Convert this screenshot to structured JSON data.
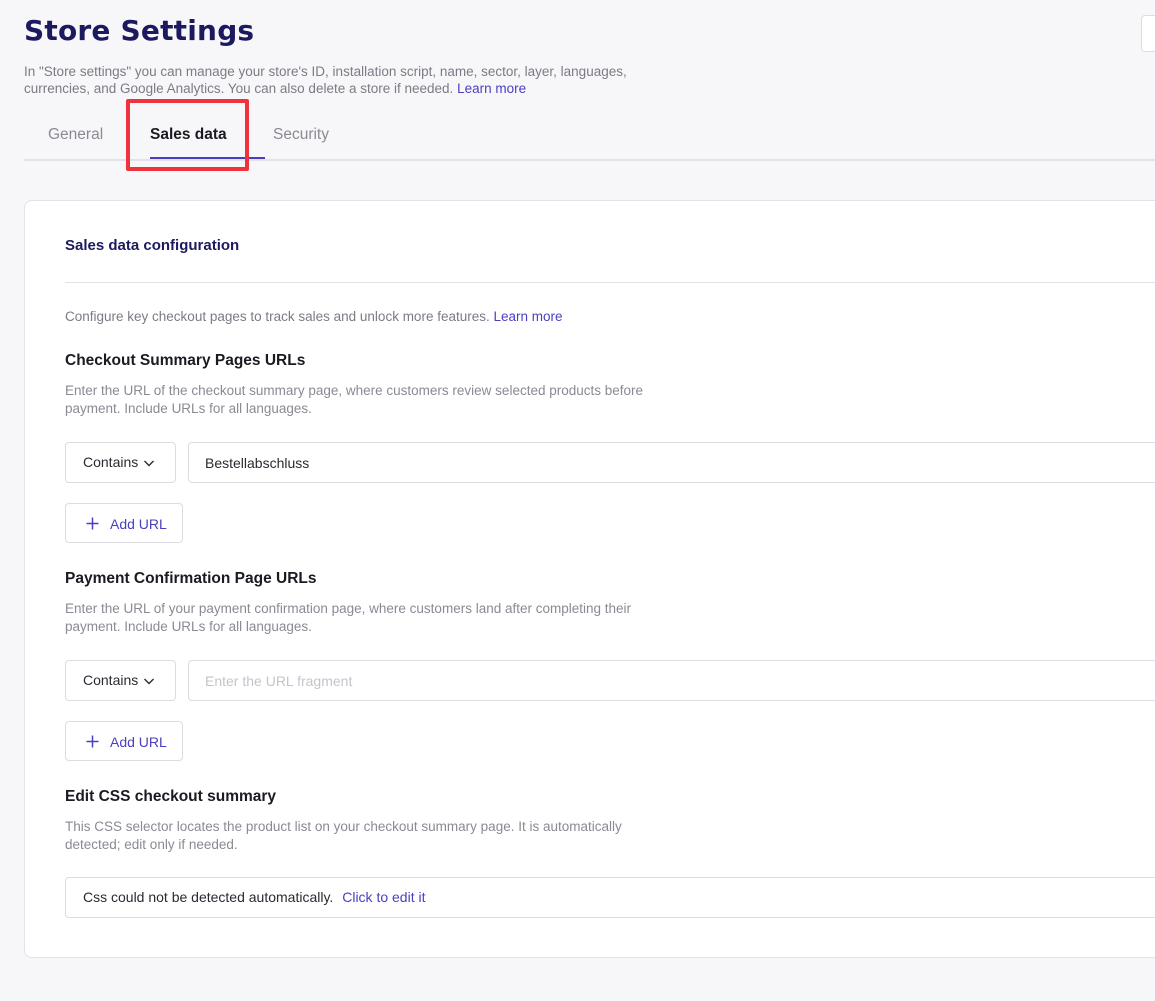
{
  "header": {
    "title": "Store Settings",
    "description": "In \"Store settings\" you can manage your store's ID, installation script, name, sector, layer, languages, currencies, and Google Analytics. You can also delete a store if needed.",
    "learn_more": "Learn more"
  },
  "tabs": [
    {
      "label": "General",
      "active": false
    },
    {
      "label": "Sales data",
      "active": true
    },
    {
      "label": "Security",
      "active": false
    }
  ],
  "card": {
    "title": "Sales data configuration",
    "intro": "Configure key checkout pages to track sales and unlock more features.",
    "intro_link": "Learn more",
    "checkout": {
      "title": "Checkout Summary Pages URLs",
      "description": "Enter the URL of the checkout summary page, where customers review selected products before payment. Include URLs for all languages.",
      "match_type": "Contains",
      "url_value": "Bestellabschluss",
      "add_label": "Add URL"
    },
    "payment": {
      "title": "Payment Confirmation Page URLs",
      "description": "Enter the URL of your payment confirmation page, where customers land after completing their payment. Include URLs for all languages.",
      "match_type": "Contains",
      "url_value": "",
      "url_placeholder": "Enter the URL fragment",
      "add_label": "Add URL"
    },
    "css": {
      "title": "Edit CSS checkout summary",
      "description": "This CSS selector locates the product list on your checkout summary page. It is automatically detected; edit only if needed.",
      "status_text": "Css could not be detected automatically.",
      "edit_link": "Click to edit it"
    }
  },
  "colors": {
    "accent": "#4a3fc0",
    "title": "#1c1a5e",
    "highlight": "#f0323d"
  },
  "icons": {
    "dropdown": "chevron-down-icon",
    "add": "plus-icon"
  }
}
